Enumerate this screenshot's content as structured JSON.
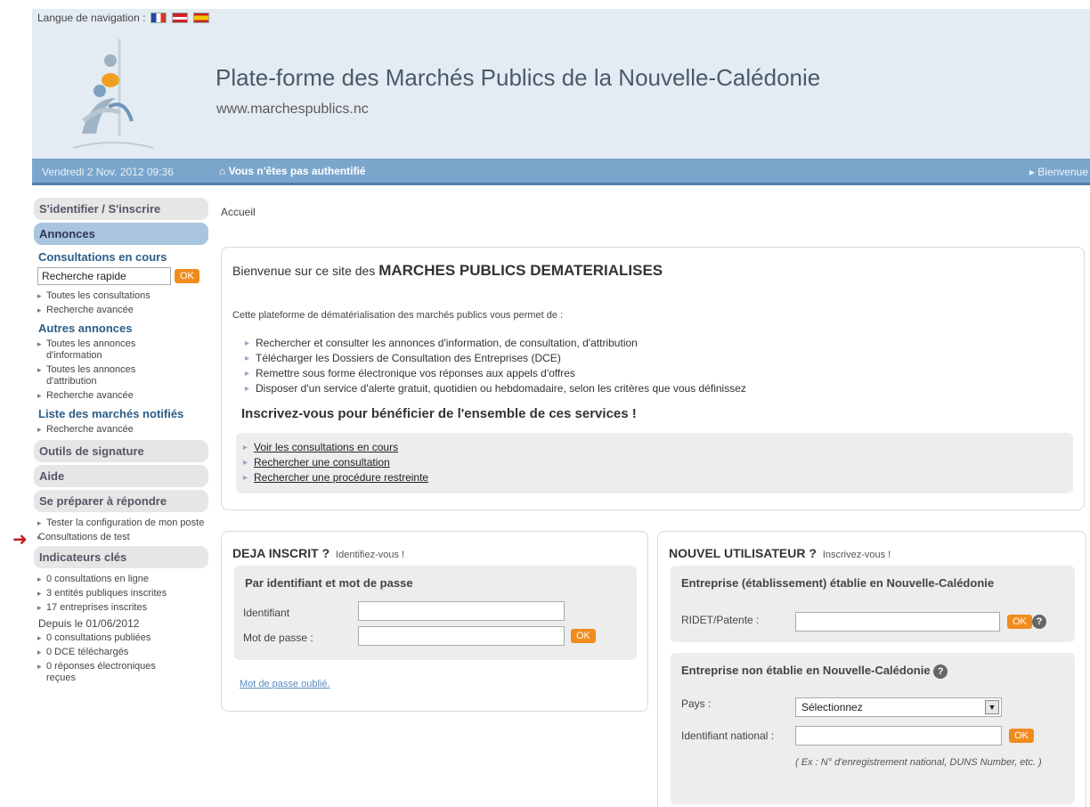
{
  "header": {
    "lang_label": "Langue de navigation :",
    "languages": [
      "fr-flag-icon",
      "en-flag-icon",
      "es-flag-icon"
    ],
    "title": "Plate-forme des Marchés Publics de la Nouvelle-Calédonie",
    "url": "www.marchespublics.nc"
  },
  "topbar": {
    "date": "Vendredi 2 Nov. 2012 09:36",
    "auth_status": "Vous n'êtes pas authentifié",
    "welcome": "Bienvenue"
  },
  "sidebar": {
    "login_label": "S'identifier / S'inscrire",
    "annonces_label": "Annonces",
    "consultations_title": "Consultations en cours",
    "quick_search_value": "Recherche rapide",
    "ok": "OK",
    "consultations_links": [
      "Toutes les consultations",
      "Recherche avancée"
    ],
    "autres_title": "Autres annonces",
    "autres_links": [
      "Toutes les annonces d'information",
      "Toutes les annonces d'attribution",
      "Recherche avancée"
    ],
    "marches_title": "Liste des marchés notifiés",
    "marches_links": [
      "Recherche avancée"
    ],
    "outils_label": "Outils de signature",
    "aide_label": "Aide",
    "preparer_label": "Se préparer à répondre",
    "preparer_links": [
      "Tester la configuration de mon poste",
      "Consultations de test"
    ],
    "indicateurs_label": "Indicateurs clés",
    "indicateurs_links": [
      "0 consultations en ligne",
      "3 entités publiques inscrites",
      "17 entreprises inscrites"
    ],
    "depuis": "Depuis le 01/06/2012",
    "depuis_links": [
      "0 consultations publiées",
      "0 DCE téléchargés",
      "0 réponses électroniques reçues"
    ]
  },
  "main": {
    "breadcrumb": "Accueil",
    "welcome_prefix": "Bienvenue sur ce site des",
    "welcome_strong": "MARCHES PUBLICS DEMATERIALISES",
    "intro": "Cette plateforme de dématérialisation des marchés publics vous permet de :",
    "features": [
      "Rechercher et consulter les annonces d'information, de consultation, d'attribution",
      "Télécharger les Dossiers de Consultation des Entreprises (DCE)",
      "Remettre sous forme électronique vos réponses aux appels d'offres",
      "Disposer d'un service d'alerte gratuit, quotidien ou hebdomadaire, selon les critères que vous définissez"
    ],
    "join": "Inscrivez-vous pour bénéficier de l'ensemble de ces services !",
    "links": [
      "Voir les consultations en cours",
      "Rechercher une consultation",
      "Rechercher une procédure restreinte"
    ]
  },
  "login": {
    "title": "DEJA INSCRIT ?",
    "subtitle": "Identifiez-vous !",
    "panel_title": "Par identifiant et mot de passe",
    "identifiant_label": "Identifiant",
    "password_label": "Mot de passe :",
    "ok": "OK",
    "forgot": "Mot de passe oublié."
  },
  "register": {
    "title": "NOUVEL UTILISATEUR ?",
    "subtitle": "Inscrivez-vous !",
    "panel1_title": "Entreprise (établissement) établie en Nouvelle-Calédonie",
    "ridet_label": "RIDET/Patente :",
    "ok": "OK",
    "panel2_title": "Entreprise non établie en Nouvelle-Calédonie",
    "pays_label": "Pays :",
    "pays_value": "Sélectionnez",
    "national_id_label": "Identifiant national :",
    "hint": "( Ex : N° d'enregistrement national, DUNS Number, etc. )"
  }
}
